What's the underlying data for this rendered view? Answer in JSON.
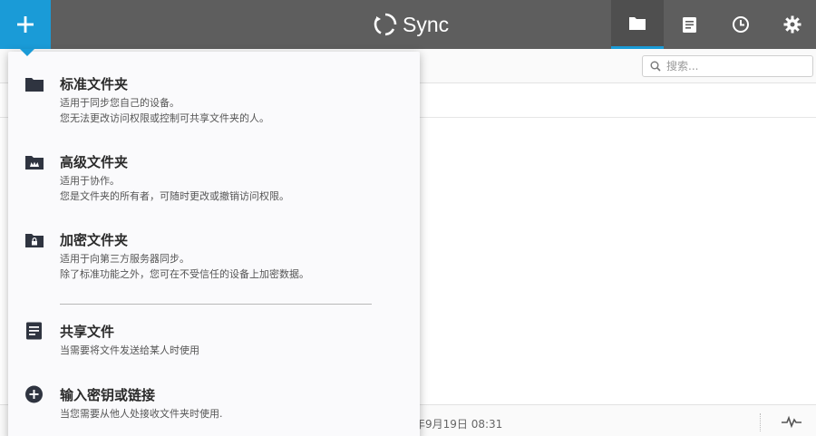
{
  "header": {
    "brand": "Sync",
    "nav": [
      "folders-icon",
      "transfers-icon",
      "history-icon",
      "settings-icon"
    ],
    "colors": {
      "header_bg": "#5e5e5e",
      "accent": "#1a9bd7"
    }
  },
  "search": {
    "placeholder": "搜索..."
  },
  "menu": {
    "items": [
      {
        "icon": "folder-icon",
        "title": "标准文件夹",
        "desc1": "适用于同步您自己的设备。",
        "desc2": "您无法更改访问权限或控制可共享文件夹的人。"
      },
      {
        "icon": "advanced-folder-icon",
        "title": "高级文件夹",
        "desc1": "适用于协作。",
        "desc2": "您是文件夹的所有者，可随时更改或撤销访问权限。"
      },
      {
        "icon": "encrypted-folder-icon",
        "title": "加密文件夹",
        "desc1": "适用于向第三方服务器同步。",
        "desc2": "除了标准功能之外，您可在不受信任的设备上加密数据。"
      },
      {
        "icon": "share-file-icon",
        "title": "共享文件",
        "desc1": "当需要将文件发送给某人时使用"
      },
      {
        "icon": "plus-circle-icon",
        "title": "输入密钥或链接",
        "desc1": "当您需要从他人处接收文件夹时使用."
      }
    ]
  },
  "status": {
    "date": "年9月19日 08:31"
  }
}
